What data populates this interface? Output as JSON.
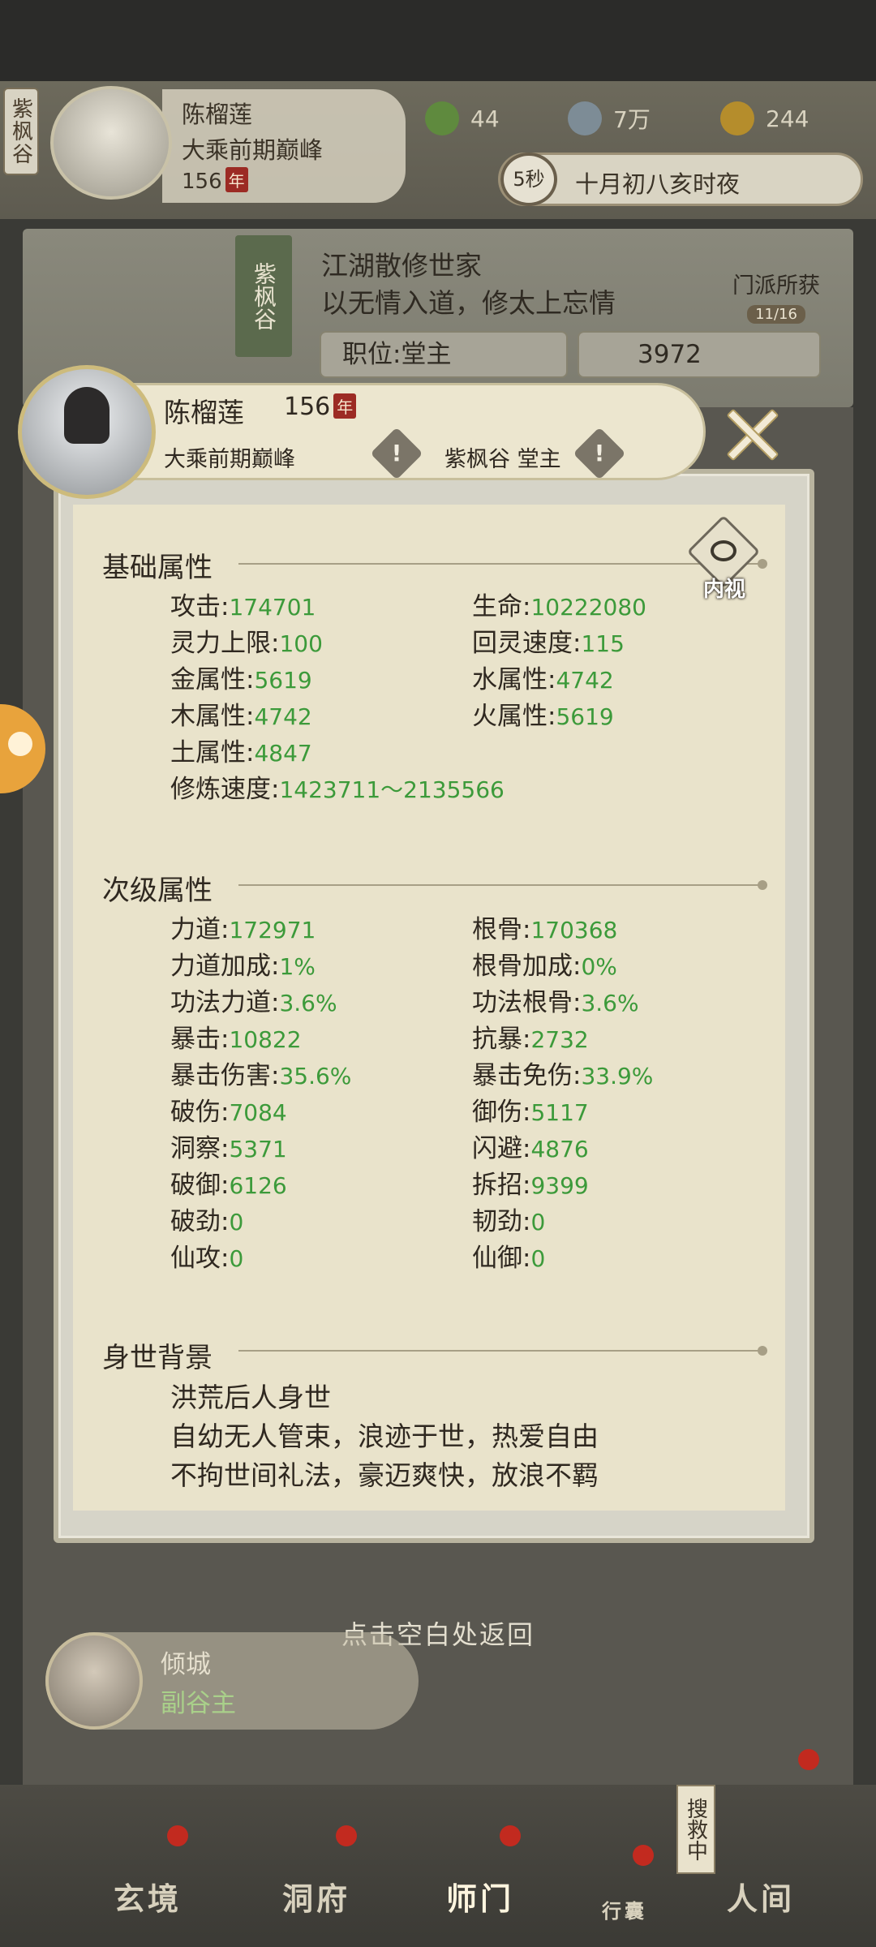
{
  "top": {
    "sect_tab": "紫枫谷",
    "player_name": "陈榴莲",
    "player_realm": "大乘前期巅峰",
    "player_age": "156",
    "age_unit": "年",
    "resources": [
      {
        "icon": "leaf-icon",
        "value": "44"
      },
      {
        "icon": "coin-icon",
        "value": "7万"
      },
      {
        "icon": "ingot-icon",
        "value": "244"
      }
    ],
    "timer_seconds": "5秒",
    "game_time": "十月初八亥时夜"
  },
  "scene": {
    "stamp": "紫枫谷",
    "line1": "江湖散修世家",
    "line2": "以无情入道，修太上忘情",
    "position_label": "职位:堂主",
    "contribution": "3972",
    "sect_reward_label": "门派所获",
    "sect_reward_count": "11/16"
  },
  "modal": {
    "name": "陈榴莲",
    "age": "156",
    "age_unit": "年",
    "realm": "大乘前期巅峰",
    "sect_role": "紫枫谷 堂主",
    "inner_view_label": "内视",
    "basic": {
      "title": "基础属性",
      "stats": [
        {
          "label": "攻击",
          "value": "174701"
        },
        {
          "label": "生命",
          "value": "10222080"
        },
        {
          "label": "灵力上限",
          "value": "100"
        },
        {
          "label": "回灵速度",
          "value": "115"
        },
        {
          "label": "金属性",
          "value": "5619"
        },
        {
          "label": "水属性",
          "value": "4742"
        },
        {
          "label": "木属性",
          "value": "4742"
        },
        {
          "label": "火属性",
          "value": "5619"
        },
        {
          "label": "土属性",
          "value": "4847"
        },
        {
          "label": "修炼速度",
          "value": "1423711～2135566"
        }
      ]
    },
    "secondary": {
      "title": "次级属性",
      "stats": [
        {
          "label": "力道",
          "value": "172971"
        },
        {
          "label": "根骨",
          "value": "170368"
        },
        {
          "label": "力道加成",
          "value": "1%"
        },
        {
          "label": "根骨加成",
          "value": "0%"
        },
        {
          "label": "功法力道",
          "value": "3.6%"
        },
        {
          "label": "功法根骨",
          "value": "3.6%"
        },
        {
          "label": "暴击",
          "value": "10822"
        },
        {
          "label": "抗暴",
          "value": "2732"
        },
        {
          "label": "暴击伤害",
          "value": "35.6%"
        },
        {
          "label": "暴击免伤",
          "value": "33.9%"
        },
        {
          "label": "破伤",
          "value": "7084"
        },
        {
          "label": "御伤",
          "value": "5117"
        },
        {
          "label": "洞察",
          "value": "5371"
        },
        {
          "label": "闪避",
          "value": "4876"
        },
        {
          "label": "破御",
          "value": "6126"
        },
        {
          "label": "拆招",
          "value": "9399"
        },
        {
          "label": "破劲",
          "value": "0"
        },
        {
          "label": "韧劲",
          "value": "0"
        },
        {
          "label": "仙攻",
          "value": "0"
        },
        {
          "label": "仙御",
          "value": "0"
        }
      ]
    },
    "background": {
      "title": "身世背景",
      "lines": [
        "洪荒后人身世",
        "自幼无人管束，浪迹于世，热爱自由",
        "不拘世间礼法，豪迈爽快，放浪不羁"
      ]
    }
  },
  "return_hint": "点击空白处返回",
  "deputy": {
    "name": "倾城",
    "title": "副谷主"
  },
  "nav": {
    "items": [
      "玄境",
      "洞府",
      "师门",
      "行囊",
      "人间"
    ],
    "rescue_tag": "搜救中"
  }
}
